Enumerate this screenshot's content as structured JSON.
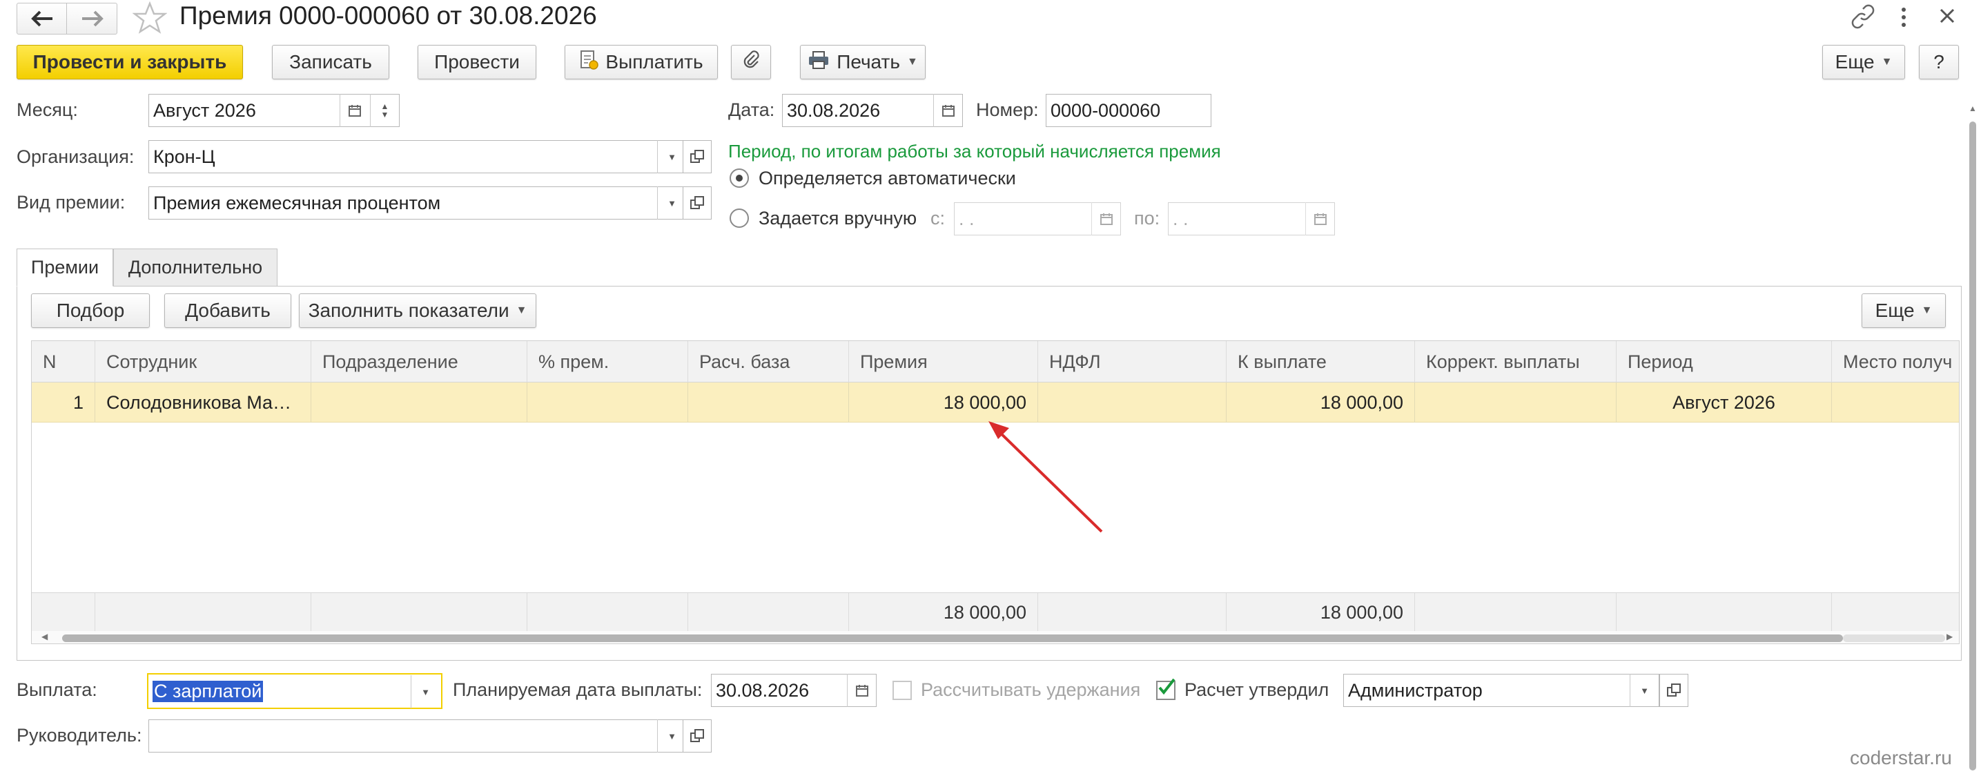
{
  "window": {
    "title": "Премия 0000-000060 от 30.08.2026"
  },
  "toolbar": {
    "post_close": "Провести и закрыть",
    "save": "Записать",
    "post": "Провести",
    "pay": "Выплатить",
    "print": "Печать",
    "more": "Еще",
    "help": "?"
  },
  "form": {
    "month_label": "Месяц:",
    "month_value": "Август 2026",
    "date_label": "Дата:",
    "date_value": "30.08.2026",
    "number_label": "Номер:",
    "number_value": "0000-000060",
    "org_label": "Организация:",
    "org_value": "Крон-Ц",
    "bonus_type_label": "Вид премии:",
    "bonus_type_value": "Премия ежемесячная процентом",
    "period_hint": "Период, по итогам работы за который начисляется премия",
    "radio_auto": "Определяется автоматически",
    "radio_manual": "Задается вручную",
    "from_label": "с:",
    "from_value": " .  .",
    "to_label": "по:",
    "to_value": " .  ."
  },
  "tabs": [
    {
      "label": "Премии"
    },
    {
      "label": "Дополнительно"
    }
  ],
  "tab_toolbar": {
    "pick": "Подбор",
    "add": "Добавить",
    "fill": "Заполнить показатели",
    "more": "Еще"
  },
  "table": {
    "columns": [
      "N",
      "Сотрудник",
      "Подразделение",
      "% прем.",
      "Расч. база",
      "Премия",
      "НДФЛ",
      "К выплате",
      "Коррект. выплаты",
      "Период",
      "Место получ"
    ],
    "rows": [
      {
        "n": "1",
        "employee": "Солодовникова Ма…",
        "department": "",
        "percent": "",
        "base": "",
        "bonus": "18 000,00",
        "ndfl": "",
        "payable": "18 000,00",
        "correction": "",
        "period": "Август 2026",
        "place": ""
      }
    ],
    "footer": {
      "bonus": "18 000,00",
      "payable": "18 000,00"
    }
  },
  "bottom": {
    "payment_label": "Выплата:",
    "payment_value": "С зарплатой",
    "planned_date_label": "Планируемая дата выплаты:",
    "planned_date_value": "30.08.2026",
    "calc_deductions": "Рассчитывать удержания",
    "approved_label": "Расчет утвердил",
    "approved_value": "Администратор",
    "manager_label": "Руководитель:",
    "manager_value": ""
  },
  "watermark": "coderstar.ru",
  "colors": {
    "primary_button": "#f3cf00",
    "selected_row": "#fbefbf",
    "hint_text": "#1a9a3c",
    "arrow": "#d92b2b"
  }
}
